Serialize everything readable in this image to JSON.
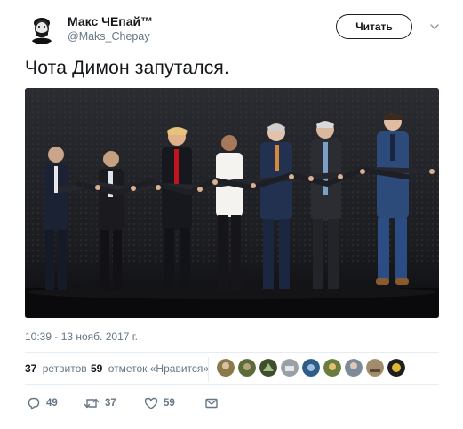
{
  "author": {
    "name": "Макс ЧЕпай™",
    "handle": "@Maks_Chepay",
    "avatar_icon": "caricature-portrait-avatar"
  },
  "follow_button": {
    "label": "Читать"
  },
  "tweet": {
    "text": "Чота Димон запутался."
  },
  "photo": {
    "description_icon": "leaders-crossed-arms-handshake-photo",
    "background_color": "#1a1b1f"
  },
  "timestamp": "10:39 - 13 нояб. 2017 г.",
  "stats": {
    "retweets_count": "37",
    "retweets_label": "ретвитов",
    "likes_count": "59",
    "likes_label": "отметок «Нравится»"
  },
  "likers": [
    {
      "icon": "liker-avatar-1",
      "color": "#8a7a4a"
    },
    {
      "icon": "liker-avatar-2",
      "color": "#5c6b3a"
    },
    {
      "icon": "liker-avatar-3",
      "color": "#3d4f2b"
    },
    {
      "icon": "liker-avatar-4",
      "color": "#9aa0a6"
    },
    {
      "icon": "liker-avatar-5",
      "color": "#2f5d8a"
    },
    {
      "icon": "liker-avatar-6",
      "color": "#6b7c3f"
    },
    {
      "icon": "liker-avatar-7",
      "color": "#7d8a99"
    },
    {
      "icon": "liker-avatar-8",
      "color": "#a38b6d"
    },
    {
      "icon": "liker-avatar-9",
      "color": "#1f1f1f"
    }
  ],
  "actions": {
    "reply_count": "49",
    "retweet_count": "37",
    "like_count": "59"
  },
  "colors": {
    "text": "#14171a",
    "secondary": "#657786",
    "divider": "#e6ecf0"
  }
}
